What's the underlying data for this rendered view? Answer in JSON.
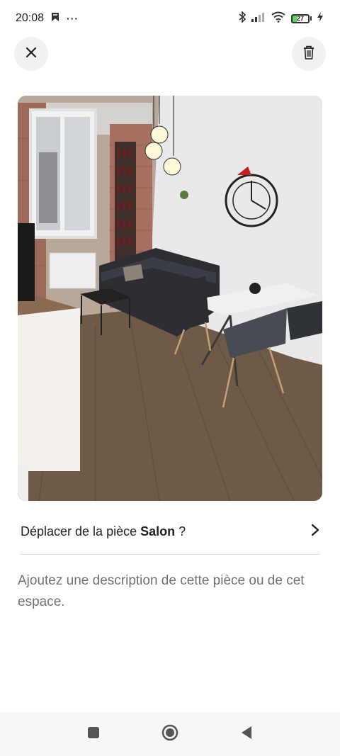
{
  "status_bar": {
    "time": "20:08",
    "notification_icons": [
      "app-notification-icon"
    ],
    "more_dots": "···",
    "battery_level": "27",
    "icons": [
      "bluetooth-icon",
      "signal-icon",
      "wifi-icon",
      "battery-icon",
      "charging-icon"
    ]
  },
  "header": {
    "close_icon": "close-icon",
    "delete_icon": "trash-icon"
  },
  "photo": {
    "subject": "living-room-photo"
  },
  "move_row": {
    "prefix": "Déplacer de la pièce ",
    "room": "Salon",
    "suffix": " ?",
    "icon": "chevron-right-icon"
  },
  "description": {
    "placeholder": "Ajoutez une description de cette pièce ou de cet espace."
  },
  "navigation_bar": {
    "buttons": [
      "recents-button",
      "home-button",
      "back-button"
    ]
  },
  "colors": {
    "accent_battery": "#5cd35c",
    "text_primary": "#222222",
    "text_secondary": "#717171",
    "button_bg": "#f1f1f1"
  }
}
